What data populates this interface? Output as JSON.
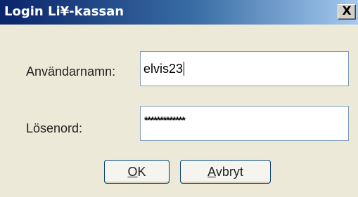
{
  "window": {
    "title": "Login Li¥-kassan",
    "close_glyph": "X"
  },
  "form": {
    "username_label": "Användarnamn:",
    "username_value": "elvis23",
    "password_label": "Lösenord:",
    "password_value": "*************"
  },
  "buttons": {
    "ok_label": "OK",
    "ok_mnemonic": "O",
    "ok_rest": "K",
    "cancel_label": "Avbryt",
    "cancel_mnemonic": "A",
    "cancel_rest": "vbryt"
  },
  "colors": {
    "titlebar_start": "#0a246a",
    "titlebar_end": "#a6caf0",
    "dialog_bg": "#ece9d8",
    "field_border": "#7f9db9",
    "button_border": "#003c74"
  },
  "icons": {
    "close": "close-icon"
  }
}
